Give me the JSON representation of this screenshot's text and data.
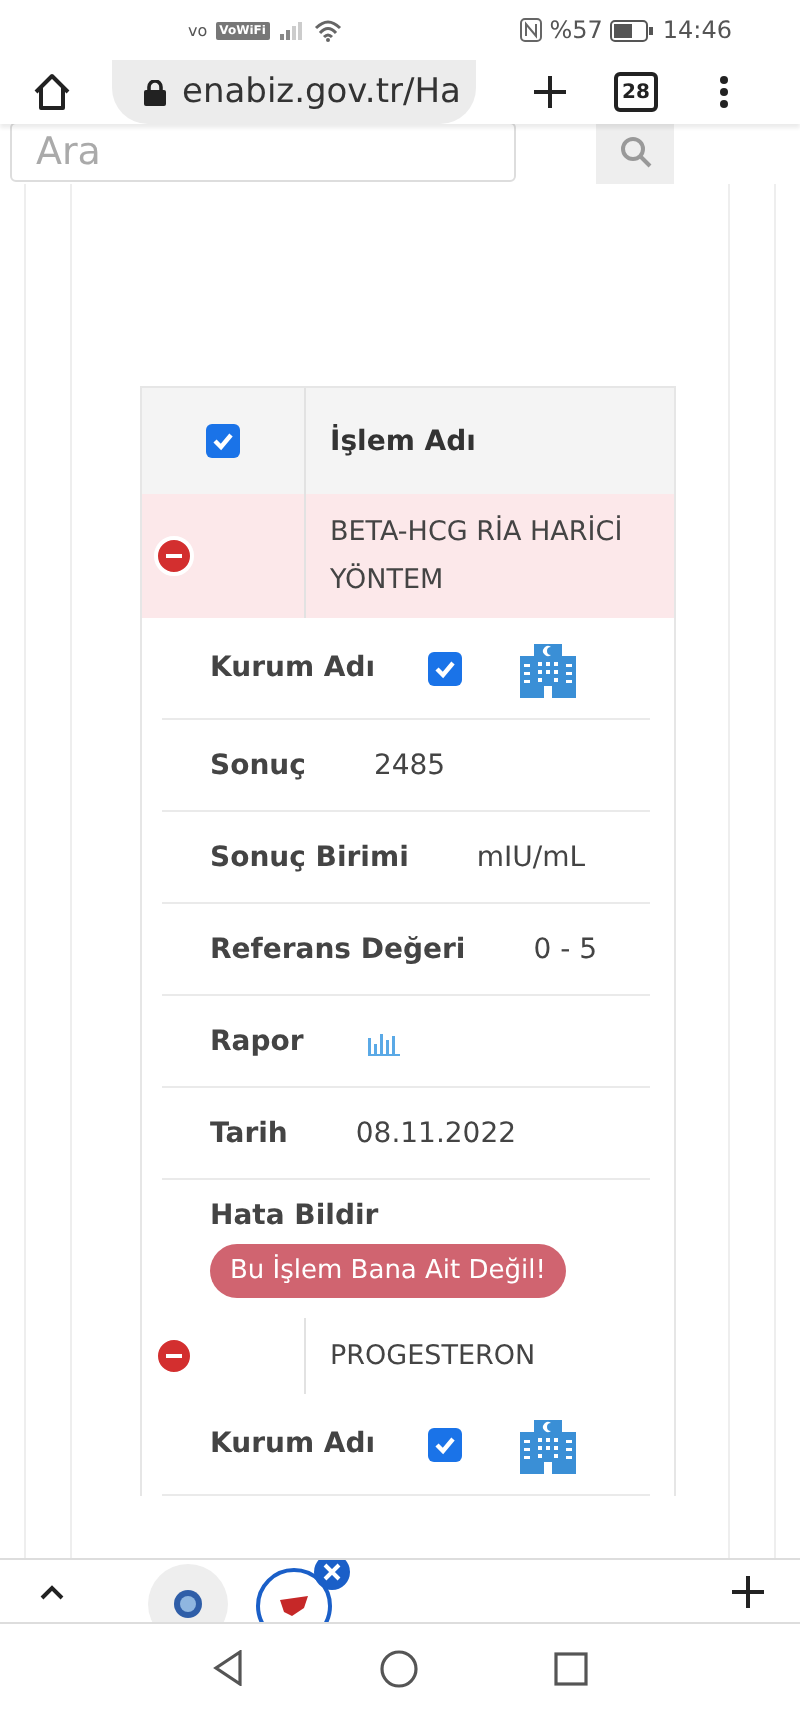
{
  "status_bar": {
    "carrier": "vo",
    "wifi_badge": "VoWiFi",
    "battery": "%57",
    "time": "14:46"
  },
  "browser": {
    "url": "enabiz.gov.tr/Ha",
    "tab_count": "28"
  },
  "search": {
    "placeholder": "Ara"
  },
  "table": {
    "header": {
      "checked": true,
      "label": "İşlem Adı"
    },
    "records": [
      {
        "name": "BETA-HCG RİA HARİCİ YÖNTEM",
        "highlighted": true,
        "expanded": true,
        "details": [
          {
            "kind": "institution",
            "label": "Kurum Adı",
            "checked": true
          },
          {
            "kind": "text",
            "label": "Sonuç",
            "value": "2485"
          },
          {
            "kind": "text",
            "label": "Sonuç Birimi",
            "value": "mIU/mL"
          },
          {
            "kind": "text",
            "label": "Referans Değeri",
            "value": "0 - 5"
          },
          {
            "kind": "report",
            "label": "Rapor"
          },
          {
            "kind": "text",
            "label": "Tarih",
            "value": "08.11.2022"
          },
          {
            "kind": "action",
            "label": "Hata Bildir",
            "button": "Bu İşlem Bana Ait Değil!"
          }
        ]
      },
      {
        "name": "PROGESTERON",
        "highlighted": false,
        "expanded": true,
        "details": [
          {
            "kind": "institution",
            "label": "Kurum Adı",
            "checked": true
          }
        ]
      }
    ]
  }
}
